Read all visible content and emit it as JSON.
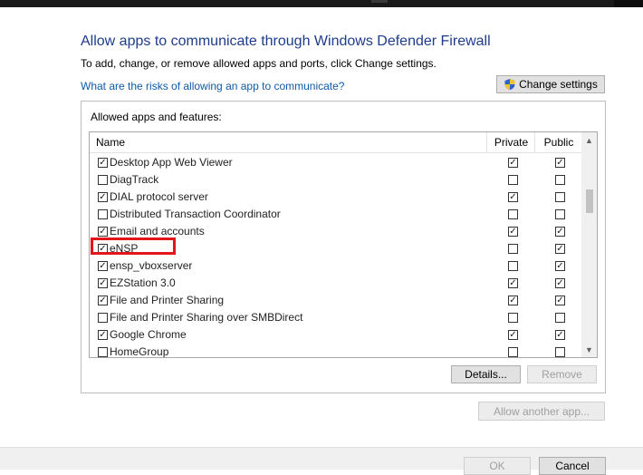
{
  "heading": "Allow apps to communicate through Windows Defender Firewall",
  "subtext": "To add, change, or remove allowed apps and ports, click Change settings.",
  "risk_link": "What are the risks of allowing an app to communicate?",
  "change_settings_label": "Change settings",
  "group_label": "Allowed apps and features:",
  "columns": {
    "name": "Name",
    "private": "Private",
    "public": "Public"
  },
  "apps": [
    {
      "name": "Desktop App Web Viewer",
      "checked": true,
      "private": true,
      "public": true
    },
    {
      "name": "DiagTrack",
      "checked": false,
      "private": false,
      "public": false
    },
    {
      "name": "DIAL protocol server",
      "checked": true,
      "private": true,
      "public": false
    },
    {
      "name": "Distributed Transaction Coordinator",
      "checked": false,
      "private": false,
      "public": false
    },
    {
      "name": "Email and accounts",
      "checked": true,
      "private": true,
      "public": true
    },
    {
      "name": "eNSP",
      "checked": true,
      "private": false,
      "public": true,
      "highlighted": true
    },
    {
      "name": "ensp_vboxserver",
      "checked": true,
      "private": false,
      "public": true
    },
    {
      "name": "EZStation 3.0",
      "checked": true,
      "private": true,
      "public": true
    },
    {
      "name": "File and Printer Sharing",
      "checked": true,
      "private": true,
      "public": true
    },
    {
      "name": "File and Printer Sharing over SMBDirect",
      "checked": false,
      "private": false,
      "public": false
    },
    {
      "name": "Google Chrome",
      "checked": true,
      "private": true,
      "public": true
    },
    {
      "name": "HomeGroup",
      "checked": false,
      "private": false,
      "public": false
    }
  ],
  "details_label": "Details...",
  "remove_label": "Remove",
  "allow_another_label": "Allow another app...",
  "ok_label": "OK",
  "cancel_label": "Cancel",
  "colors": {
    "heading": "#1e3c8c",
    "link": "#0f5aa8",
    "highlight": "#e4141b"
  }
}
